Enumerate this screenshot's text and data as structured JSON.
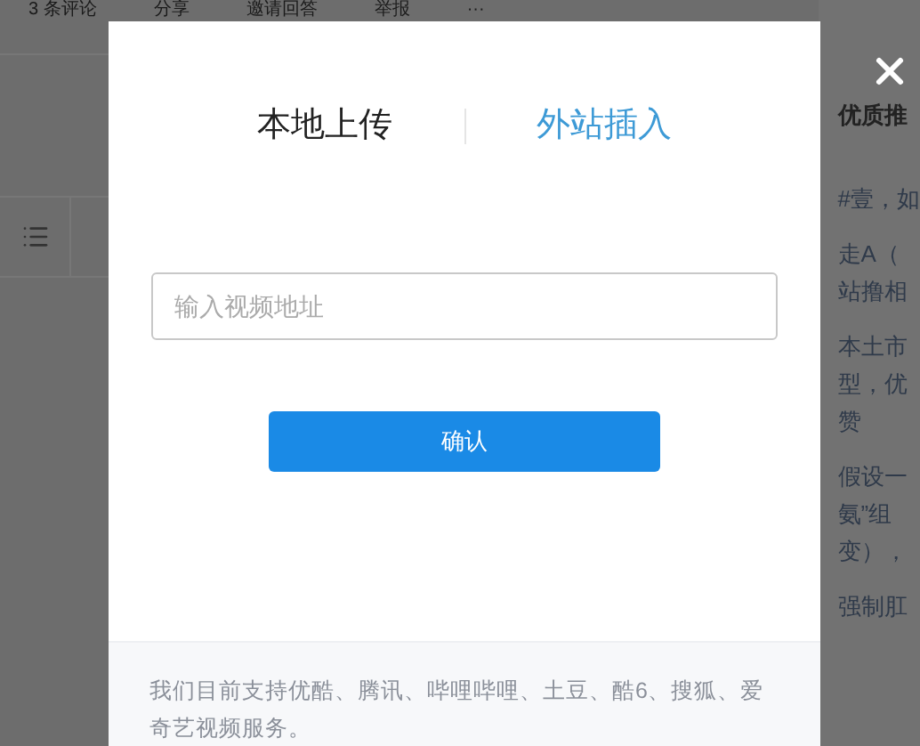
{
  "page_toolbar": [
    "3 条评论",
    "分享",
    "邀请回答",
    "举报",
    "···"
  ],
  "sidebar": {
    "title": "优质推",
    "snippets": [
      {
        "lines": [
          "#壹，如"
        ]
      },
      {
        "lines": [
          "走A（",
          "站撸相"
        ]
      },
      {
        "lines": [
          "本土市",
          "型，优",
          "赞"
        ]
      },
      {
        "lines": [
          "假设一",
          "氨”组",
          "变），"
        ]
      },
      {
        "lines": [
          "强制肛"
        ]
      }
    ]
  },
  "dialog": {
    "tabs": [
      {
        "label": "本地上传",
        "selected": false
      },
      {
        "label": "外站插入",
        "selected": true
      }
    ],
    "url_field": {
      "placeholder": "输入视频地址"
    },
    "confirm_button": "确认",
    "note": "我们目前支持优酷、腾讯、哔哩哔哩、土豆、酷6、搜狐、爱奇艺视频服务。"
  }
}
